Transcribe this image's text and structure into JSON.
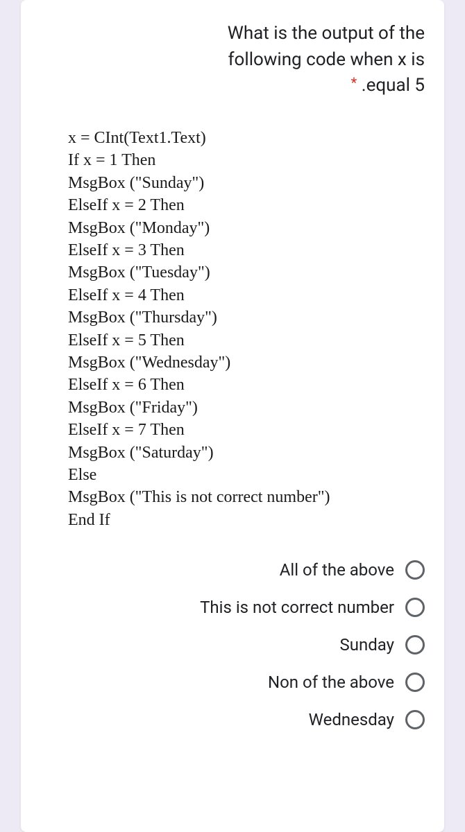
{
  "question": {
    "line1": "What is the output of the",
    "line2": "following code when x is",
    "line3": ".equal 5",
    "required_marker": "*"
  },
  "code": [
    "x = CInt(Text1.Text)",
    "If x = 1 Then",
    "MsgBox (\"Sunday\")",
    "ElseIf x = 2 Then",
    "MsgBox (\"Monday\")",
    "ElseIf x = 3 Then",
    "MsgBox (\"Tuesday\")",
    "ElseIf x = 4 Then",
    "MsgBox (\"Thursday\")",
    "ElseIf x = 5 Then",
    "MsgBox (\"Wednesday\")",
    "ElseIf x = 6 Then",
    "MsgBox (\"Friday\")",
    "ElseIf x = 7 Then",
    "MsgBox (\"Saturday\")",
    "Else",
    "MsgBox (\"This is not correct number\")",
    "End If"
  ],
  "options": [
    {
      "label": "All of the above"
    },
    {
      "label": "This is not correct number"
    },
    {
      "label": "Sunday"
    },
    {
      "label": "Non of the above"
    },
    {
      "label": "Wednesday"
    }
  ]
}
